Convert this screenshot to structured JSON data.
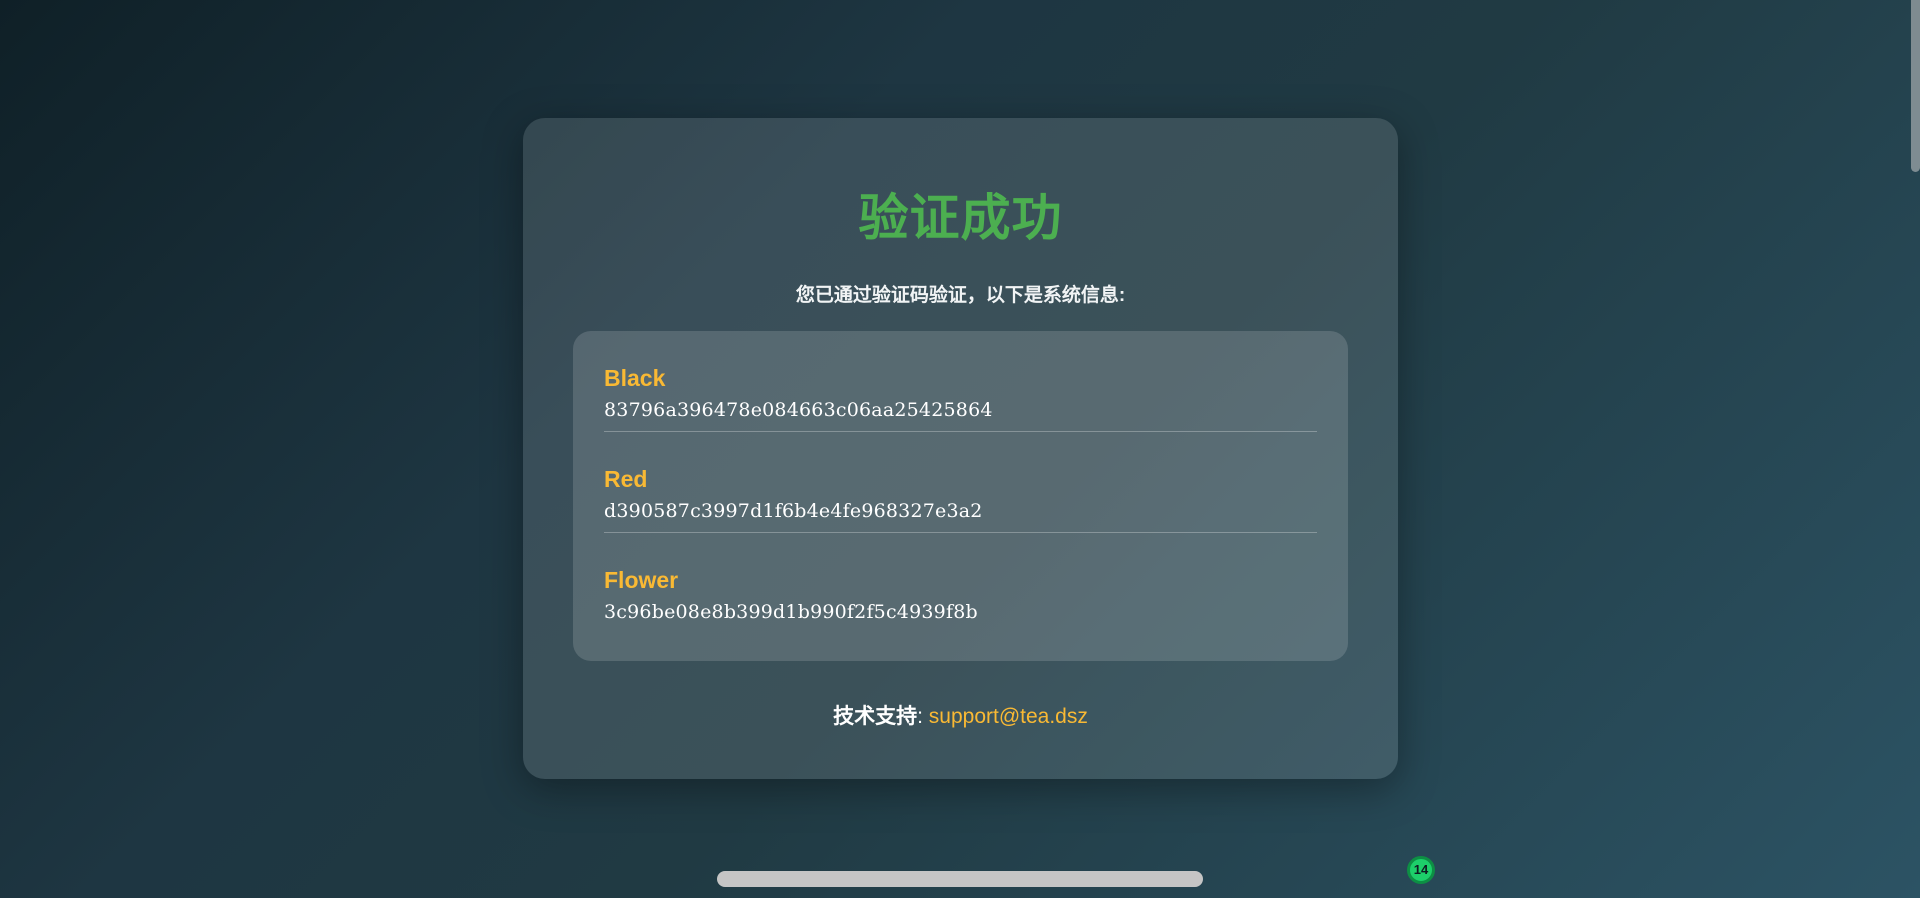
{
  "card": {
    "title": "验证成功",
    "subtitle": "您已通过验证码验证，以下是系统信息:",
    "info": [
      {
        "key": "Black",
        "value": "83796a396478e084663c06aa25425864"
      },
      {
        "key": "Red",
        "value": "d390587c3997d1f6b4e4fe968327e3a2"
      },
      {
        "key": "Flower",
        "value": "3c96be08e8b399d1b990f2f5c4939f8b"
      }
    ],
    "support": {
      "label": "技术支持",
      "separator": ": ",
      "email": "support@tea.dsz"
    }
  },
  "badge": {
    "count": "14"
  },
  "colors": {
    "title": "#4caf50",
    "accent": "#f9b934",
    "badge": "#1dcf6a"
  }
}
